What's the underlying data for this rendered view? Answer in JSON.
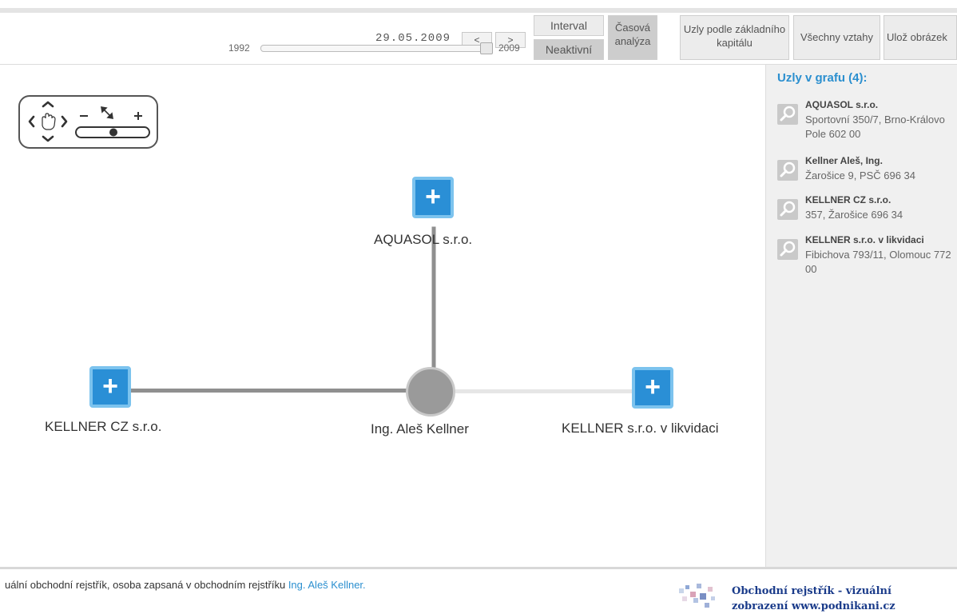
{
  "toolbar": {
    "date": "29.05.2009",
    "prev_label": "<",
    "next_label": ">",
    "year_start": "1992",
    "year_end": "2009",
    "interval_label": "Interval",
    "inactive_label": "Neaktivní",
    "time_analysis_label": "Časová analýza",
    "nodes_by_capital_label": "Uzly podle základního kapitálu",
    "all_relations_label": "Všechny vztahy",
    "save_image_label": "Ulož obrázek",
    "slider_position": 1.0
  },
  "graph": {
    "nodes": {
      "aquasol": "AQUASOL s.r.o.",
      "kellner_cz": "KELLNER CZ s.r.o.",
      "center": "Ing. Aleš Kellner",
      "kellner_liq": "KELLNER s.r.o. v likvidaci"
    },
    "plus_symbol": "+",
    "colors": {
      "node_fill": "#2a8fd6",
      "node_border": "#7cc3ee",
      "edge_active": "#8f8f8f",
      "edge_inactive": "#e6e6e6",
      "center_node": "#9a9a9a"
    }
  },
  "sidebar": {
    "title": "Uzly v grafu (4):",
    "items": [
      {
        "name": "AQUASOL s.r.o.",
        "address": "Sportovní 350/7, Brno-Královo Pole 602 00"
      },
      {
        "name": "Kellner Aleš, Ing.",
        "address": "Žarošice 9, PSČ 696 34"
      },
      {
        "name": "KELLNER CZ s.r.o.",
        "address": "357, Žarošice 696 34"
      },
      {
        "name": "KELLNER s.r.o. v likvidaci",
        "address": "Fibichova 793/11, Olomouc 772 00"
      }
    ],
    "accent": "#2b8fcf"
  },
  "footer": {
    "text": "uální obchodní rejstřík, osoba zapsaná v obchodním rejstříku ",
    "link": "Ing. Aleš Kellner.",
    "brand_line1": "Obchodní rejstřík - vizuální",
    "brand_line2": "zobrazení www.podnikani.cz"
  }
}
